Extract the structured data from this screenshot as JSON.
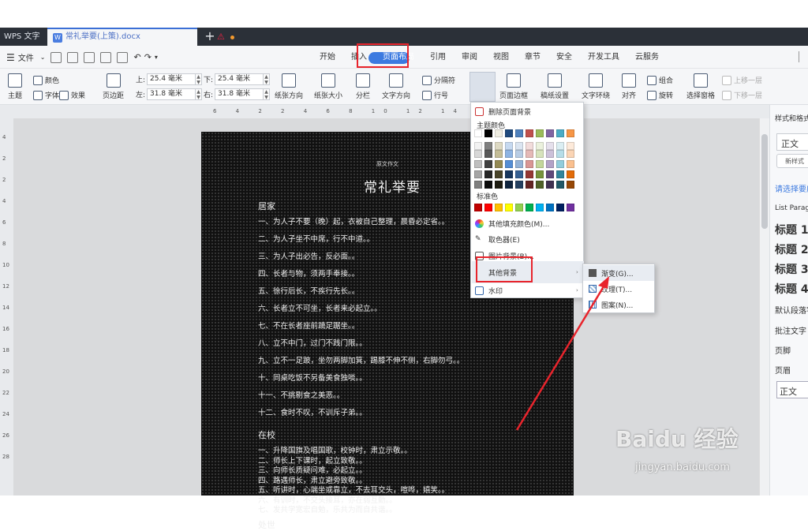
{
  "tabbar": {
    "app_name": "WPS 文字",
    "doc_name": "常礼举要(上策).docx",
    "doc_icon": "W",
    "add_tab": "+"
  },
  "menubar": {
    "file_label": "文件",
    "tabs": [
      "开始",
      "插入",
      "页面布局",
      "引用",
      "审阅",
      "视图",
      "章节",
      "安全",
      "开发工具",
      "云服务"
    ],
    "active_tab": "页面布局"
  },
  "ribbon": {
    "theme": "主题",
    "colors": "颜色",
    "fonts": "字体",
    "effects": "效果",
    "margins": "页边距",
    "top_label": "上:",
    "top_value": "25.4 毫米",
    "bottom_label": "下:",
    "bottom_value": "25.4 毫米",
    "left_label": "左:",
    "left_value": "31.8 毫米",
    "right_label": "右:",
    "right_value": "31.8 毫米",
    "orientation": "纸张方向",
    "size": "纸张大小",
    "columns": "分栏",
    "text_direction": "文字方向",
    "breaks": "分隔符",
    "line_numbers": "行号",
    "background": "背景",
    "page_border": "页面边框",
    "manuscript": "稿纸设置",
    "wrap": "文字环绕",
    "align": "对齐",
    "group": "组合",
    "rotate": "旋转",
    "selection_pane": "选择窗格",
    "bring_forward": "上移一层",
    "send_backward": "下移一层"
  },
  "ruler": {
    "ticks": "6 4 2 2 4 6 8 10 12 14 16 18 20",
    "vticks": [
      "4",
      "2",
      "2",
      "4",
      "6",
      "8",
      "10",
      "12",
      "14",
      "16",
      "18",
      "20",
      "22",
      "24",
      "26",
      "28"
    ]
  },
  "document": {
    "small_heading": "原文作文",
    "title": "常礼举要",
    "lines": [
      {
        "text": "居家",
        "heading": true
      },
      {
        "text": "一、为人子不要（晚）起，衣被自己整理，晨昏必定省。。",
        "heading": false
      },
      {
        "text": "二、为人子坐不中席，行不中道。。",
        "heading": false
      },
      {
        "text": "三、为人子出必告，反必面。。",
        "heading": false
      },
      {
        "text": "四、长者与物，须两手奉接。。",
        "heading": false
      },
      {
        "text": "五、徐行后长，不疾行先长。。",
        "heading": false
      },
      {
        "text": "六、长者立不可坐，长者来必起立。。",
        "heading": false
      },
      {
        "text": "七、不在长者座前蹺足踞坐。。",
        "heading": false
      },
      {
        "text": "八、立不中门，过门不践门限。。",
        "heading": false
      },
      {
        "text": "九、立不一足跛，坐勿两脚加箕，踢膝不伸不侧，右脚勿弓。。",
        "heading": false
      },
      {
        "text": "十、同桌吃饭不另备美食独啖。。",
        "heading": false
      },
      {
        "text": "十一、不挑剔食之美恶。。",
        "heading": false
      },
      {
        "text": "十二、食时不叹，不训斥子弟。。",
        "heading": false
      },
      {
        "text": "在校",
        "heading": true
      },
      {
        "text": "一、升降国旗及唱国歌，校钟时，肃立示敬。。",
        "heading": false
      },
      {
        "text": "二、师长上下课时，起立致敬。。",
        "heading": false
      },
      {
        "text": "三、向师长质疑问难，必起立。。",
        "heading": false
      },
      {
        "text": "四、路遇师长，肃立避旁致敬。。",
        "heading": false
      },
      {
        "text": "五、听讲时，心端坐或靠立，不去耳交头，喧哗，嬉笑。。",
        "heading": false
      },
      {
        "text": "六、有训时，不交头接耳，亦在弱互勤。。",
        "heading": false
      },
      {
        "text": "七、发共学宽宏自勉，乐共为而自共谐。。",
        "heading": false
      },
      {
        "text": "处世",
        "heading": true
      }
    ]
  },
  "dropdown": {
    "remove_bg": "删除页面背景",
    "theme_colors": "主题颜色",
    "standard_colors": "标准色",
    "more_fill": "其他填充颜色(M)...",
    "picker": "取色器(E)",
    "image_bg": "图片背景(B)...",
    "other_bg": "其他背景",
    "watermark": "水印"
  },
  "submenu": {
    "gradient": "渐变(G)...",
    "texture": "纹理(T)...",
    "pattern": "图案(N)..."
  },
  "styles_panel": {
    "title": "样式和格式",
    "current": "正文",
    "new_style": "新样式",
    "pick": "请选择要应用的格式",
    "items": [
      "List Paragraph",
      "标题 1",
      "标题 2",
      "标题 3",
      "标题 4",
      "默认段落字体",
      "批注文字",
      "页脚",
      "页眉",
      "正文"
    ]
  },
  "watermark": {
    "brand": "Baidu 经验",
    "url": "jingyan.baidu.com"
  },
  "colors": {
    "theme_grid": [
      "#ffffff",
      "#000000",
      "#eeece1",
      "#1f497d",
      "#4f81bd",
      "#c0504d",
      "#9bbb59",
      "#8064a2",
      "#4bacc6",
      "#f79646",
      "#f2f2f2",
      "#7f7f7f",
      "#ddd9c3",
      "#c6d9f0",
      "#dbe5f1",
      "#f2dcdb",
      "#ebf1dd",
      "#e5e0ec",
      "#dbeef3",
      "#fdeada",
      "#d8d8d8",
      "#595959",
      "#c4bd97",
      "#8db3e2",
      "#b8cce4",
      "#e5b9b7",
      "#d7e3bc",
      "#ccc1d9",
      "#b7dde8",
      "#fbd5b5",
      "#bfbfbf",
      "#3f3f3f",
      "#938953",
      "#548dd4",
      "#95b3d7",
      "#d99694",
      "#c3d69b",
      "#b2a2c7",
      "#92cddc",
      "#fac08f",
      "#a5a5a5",
      "#262626",
      "#494429",
      "#17365d",
      "#366092",
      "#953734",
      "#76923c",
      "#5f497a",
      "#31859b",
      "#e36c09",
      "#7f7f7f",
      "#0c0c0c",
      "#1d1b10",
      "#0f243e",
      "#244061",
      "#632423",
      "#4f6128",
      "#3f3151",
      "#205867",
      "#974806"
    ],
    "standard": [
      "#c00000",
      "#ff0000",
      "#ffc000",
      "#ffff00",
      "#92d050",
      "#00b050",
      "#00b0f0",
      "#0070c0",
      "#002060",
      "#7030a0"
    ],
    "accent": "#3c7ae0",
    "highlight_red": "#e8242c"
  }
}
